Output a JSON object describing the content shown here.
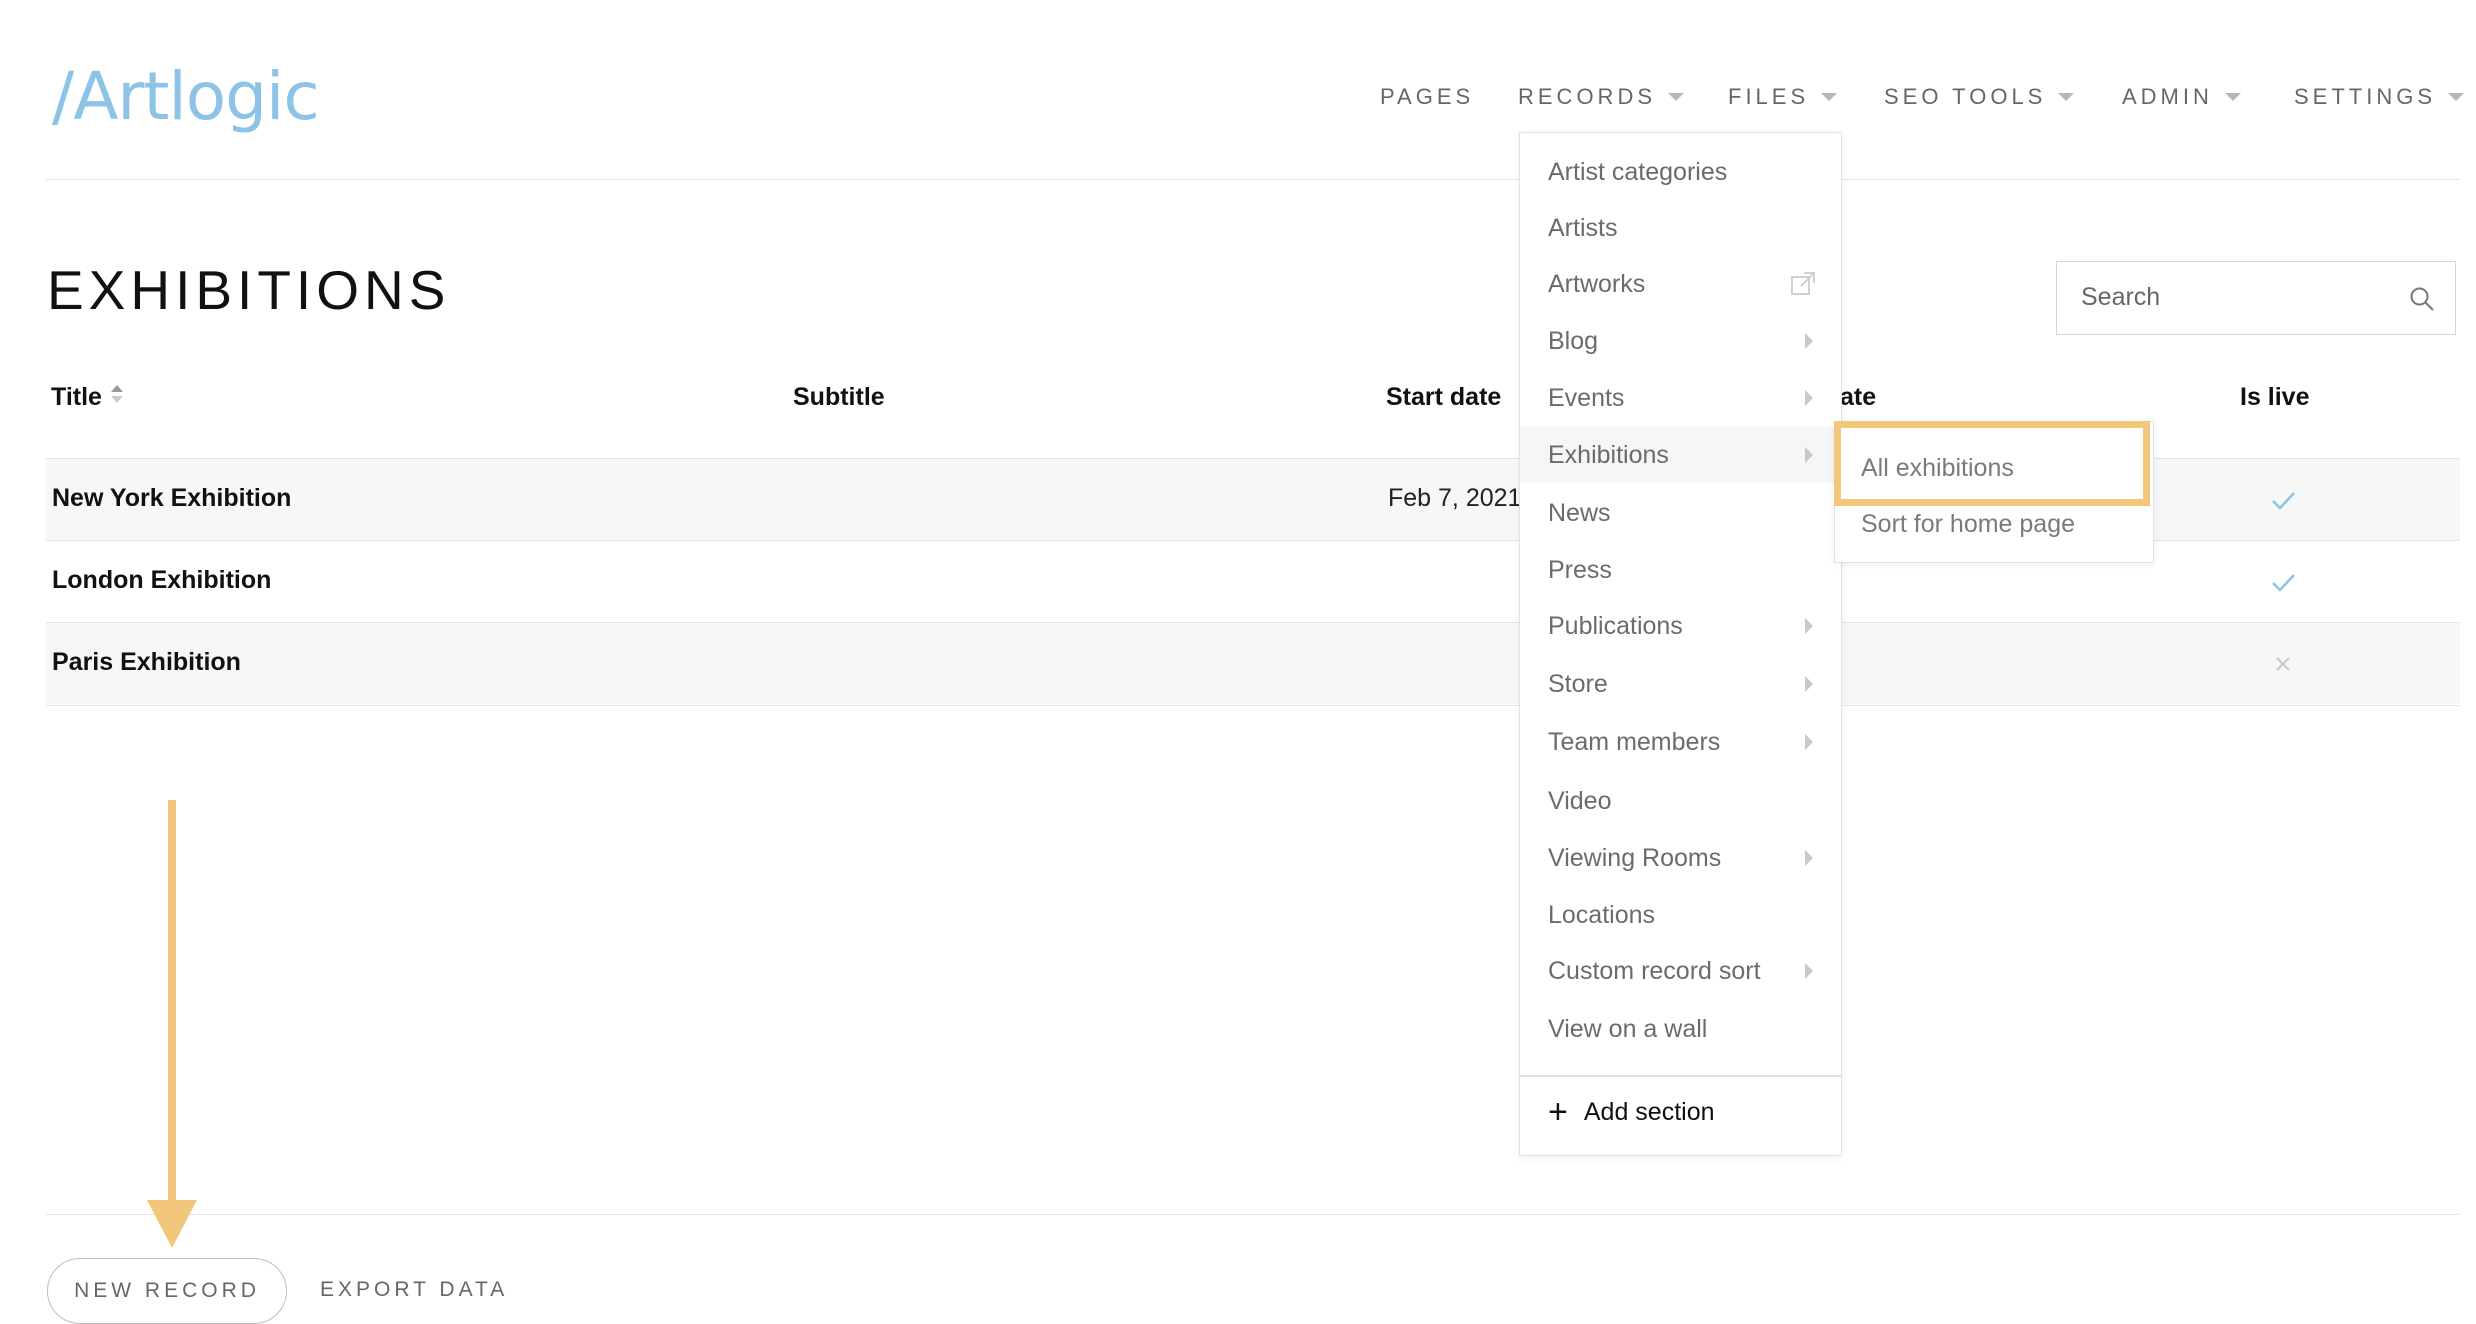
{
  "brand": {
    "logo": "/Artlogic"
  },
  "nav": {
    "items": [
      {
        "label": "PAGES",
        "caret": false
      },
      {
        "label": "RECORDS",
        "caret": true
      },
      {
        "label": "FILES",
        "caret": true
      },
      {
        "label": "SEO TOOLS",
        "caret": true
      },
      {
        "label": "ADMIN",
        "caret": true
      },
      {
        "label": "SETTINGS",
        "caret": true
      }
    ]
  },
  "page": {
    "title": "EXHIBITIONS"
  },
  "search": {
    "placeholder": "Search"
  },
  "table": {
    "columns": [
      "Title",
      "Subtitle",
      "Start date",
      "ate",
      "Is live"
    ],
    "rows": [
      {
        "title": "New York Exhibition",
        "start_date": "Feb 7, 2021",
        "live": "check"
      },
      {
        "title": "London Exhibition",
        "start_date": "",
        "live": "check"
      },
      {
        "title": "Paris Exhibition",
        "start_date": "",
        "live": "cross"
      }
    ]
  },
  "records_menu": {
    "items": [
      {
        "label": "Artist categories"
      },
      {
        "label": "Artists"
      },
      {
        "label": "Artworks",
        "icon": "external-link-icon"
      },
      {
        "label": "Blog",
        "submenu": true
      },
      {
        "label": "Events",
        "submenu": true
      },
      {
        "label": "Exhibitions",
        "submenu": true,
        "active": true
      },
      {
        "label": "News"
      },
      {
        "label": "Press"
      },
      {
        "label": "Publications",
        "submenu": true
      },
      {
        "label": "Store",
        "submenu": true
      },
      {
        "label": "Team members",
        "submenu": true
      },
      {
        "label": "Video"
      },
      {
        "label": "Viewing Rooms",
        "submenu": true
      },
      {
        "label": "Locations"
      },
      {
        "label": "Custom record sort",
        "submenu": true
      },
      {
        "label": "View on a wall"
      }
    ],
    "add_section": "Add section"
  },
  "exhibitions_submenu": {
    "items": [
      "All exhibitions",
      "Sort for home page"
    ],
    "highlighted": "All exhibitions"
  },
  "footer": {
    "new_record": "NEW RECORD",
    "export_data": "EXPORT DATA"
  },
  "colors": {
    "accent": "#f3c77b",
    "logo": "#8ec3e8",
    "check": "#8ec3e8"
  }
}
